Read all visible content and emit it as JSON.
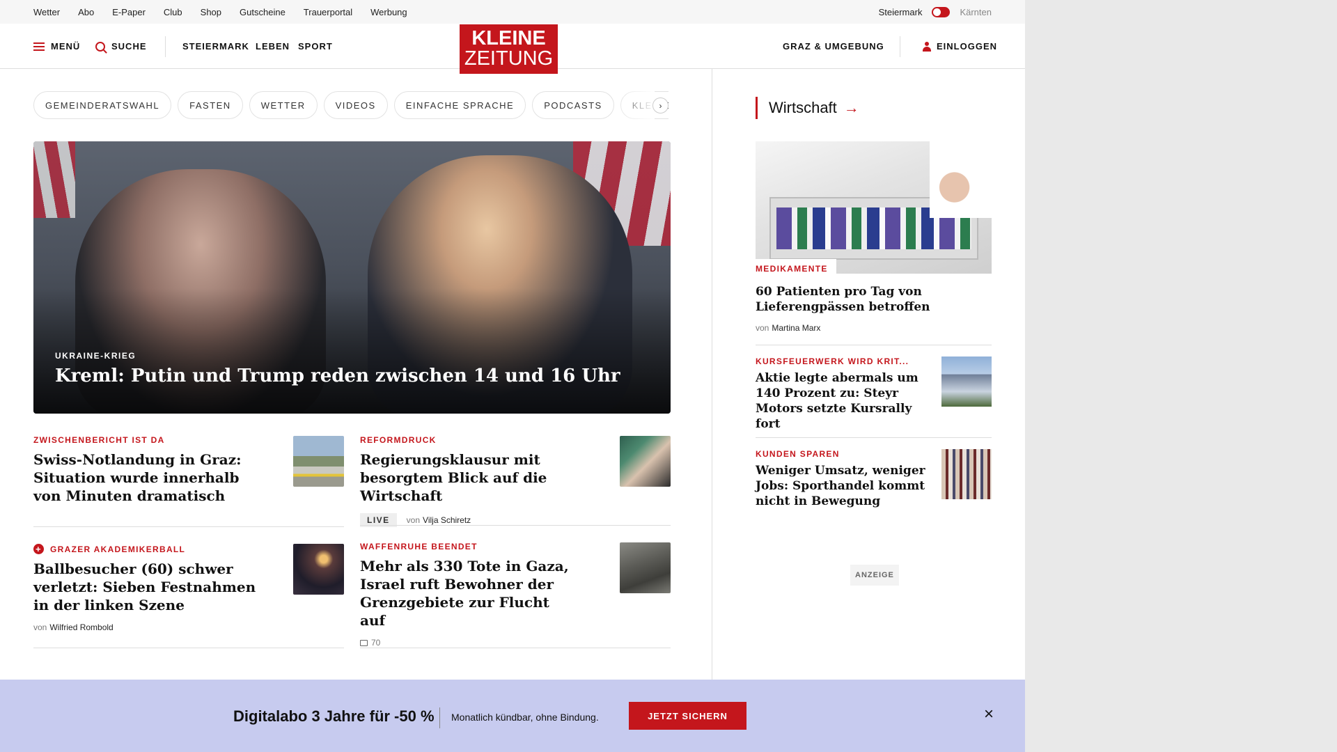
{
  "utility": {
    "links": [
      "Wetter",
      "Abo",
      "E-Paper",
      "Club",
      "Shop",
      "Gutscheine",
      "Trauerportal",
      "Werbung"
    ],
    "region_active": "Steiermark",
    "region_inactive": "Kärnten"
  },
  "header": {
    "menu_label": "MENÜ",
    "search_label": "SUCHE",
    "nav": [
      "STEIERMARK",
      "LEBEN",
      "SPORT"
    ],
    "logo_line1": "KLEINE",
    "logo_line2": "ZEITUNG",
    "region_link": "GRAZ & UMGEBUNG",
    "login_label": "EINLOGGEN"
  },
  "chips": [
    "GEMEINDERATSWAHL",
    "FASTEN",
    "WETTER",
    "VIDEOS",
    "EINFACHE SPRACHE",
    "PODCASTS",
    "KLEINE KINDER"
  ],
  "chips_next": "›",
  "hero": {
    "kicker": "UKRAINE-KRIEG",
    "title": "Kreml: Putin und Trump reden zwischen 14 und 16 Uhr"
  },
  "articles": [
    {
      "kicker": "ZWISCHENBERICHT IST DA",
      "title": "Swiss-Notlandung in Graz: Situation wurde innerhalb von Minuten dramatisch"
    },
    {
      "kicker": "REFORMDRUCK",
      "title": "Regierungsklausur mit besorgtem Blick auf die Wirtschaft",
      "live": "LIVE",
      "by": "von",
      "author": "Vilja Schiretz"
    },
    {
      "kicker": "GRAZER AKADEMIKERBALL",
      "title": "Ballbesucher (60) schwer verletzt: Sieben Festnahmen in der linken Szene",
      "by": "von",
      "author": "Wilfried Rombold"
    },
    {
      "kicker": "WAFFENRUHE BEENDET",
      "title": "Mehr als 330 Tote in Gaza, Israel ruft Bewohner der Grenzgebiete zur Flucht auf",
      "comments": "70"
    }
  ],
  "sidebar": {
    "heading": "Wirtschaft",
    "arrow": "→",
    "lead": {
      "kicker": "MEDIKAMENTE",
      "title": "60 Patienten pro Tag von Lieferengpässen betroffen",
      "by": "von",
      "author": "Martina Marx"
    },
    "items": [
      {
        "kicker": "KURSFEUERWERK WIRD KRIT...",
        "title": "Aktie legte abermals um 140 Prozent zu: Steyr Motors setzte Kursrally fort"
      },
      {
        "kicker": "KUNDEN SPAREN",
        "title": "Weniger Umsatz, weniger Jobs: Sporthandel kommt nicht in Bewegung"
      }
    ],
    "ad_label": "ANZEIGE"
  },
  "promo": {
    "headline": "Digitalabo 3 Jahre für -50 %",
    "subline": "Monatlich kündbar, ohne Bindung.",
    "cta": "JETZT SICHERN",
    "close": "×"
  },
  "colors": {
    "brand": "#c4161c",
    "promo_bg": "#c7cbef"
  }
}
